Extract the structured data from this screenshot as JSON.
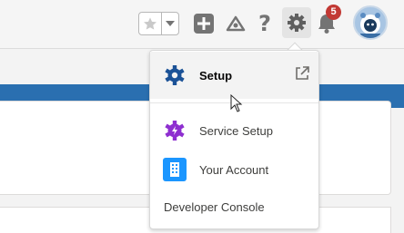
{
  "header": {
    "notification_count": "5",
    "help_glyph": "?",
    "icons": [
      "star-icon",
      "chevron-down-icon",
      "plus-icon",
      "trailhead-icon",
      "help-icon",
      "gear-icon",
      "bell-icon",
      "avatar"
    ]
  },
  "menu": {
    "items": [
      {
        "label": "Setup",
        "icon": "gear-icon",
        "color": "#1b5297",
        "highlighted": true,
        "external": true
      },
      {
        "label": "Service Setup",
        "icon": "gear-icon",
        "color": "#8e2fd0"
      },
      {
        "label": "Your Account",
        "icon": "building-icon",
        "color": "#1b96ff"
      },
      {
        "label": "Developer Console"
      }
    ]
  },
  "colors": {
    "banner": "#2a6fb0",
    "badge": "#c23934"
  }
}
